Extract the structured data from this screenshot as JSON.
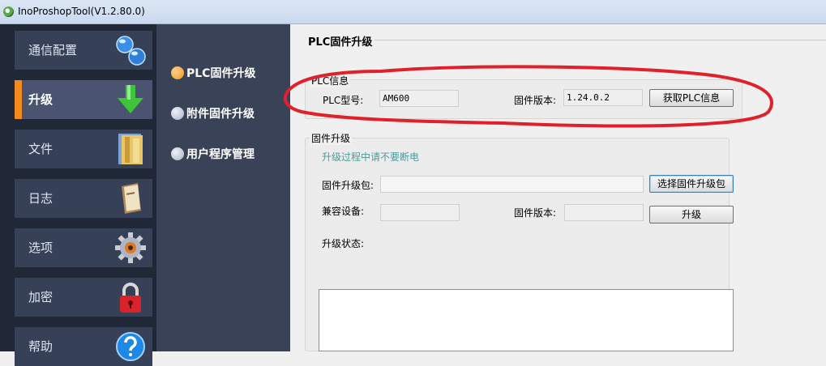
{
  "window": {
    "title": "InoProshopTool(V1.2.80.0)"
  },
  "sidebar": {
    "items": [
      {
        "label": "通信配置",
        "icon": "network-globes-icon"
      },
      {
        "label": "升级",
        "icon": "download-arrow-icon",
        "active": true
      },
      {
        "label": "文件",
        "icon": "folder-icon"
      },
      {
        "label": "日志",
        "icon": "book-icon"
      },
      {
        "label": "选项",
        "icon": "gear-icon"
      },
      {
        "label": "加密",
        "icon": "lock-icon"
      },
      {
        "label": "帮助",
        "icon": "help-icon"
      }
    ]
  },
  "submenu": {
    "items": [
      {
        "label": "PLC固件升级",
        "active": true
      },
      {
        "label": "附件固件升级"
      },
      {
        "label": "用户程序管理"
      }
    ]
  },
  "main": {
    "title": "PLC固件升级",
    "plc_info": {
      "group_title": "PLC信息",
      "model_label": "PLC型号:",
      "model_value": "AM600",
      "fw_version_label": "固件版本:",
      "fw_version_value": "1.24.0.2",
      "get_button": "获取PLC信息"
    },
    "firmware_upgrade": {
      "group_title": "固件升级",
      "hint": "升级过程中请不要断电",
      "package_label": "固件升级包:",
      "package_value": "",
      "select_button": "选择固件升级包",
      "compat_label": "兼容设备:",
      "compat_value": "",
      "fw_version_label": "固件版本:",
      "fw_version_value": "",
      "upgrade_button": "升级",
      "status_label": "升级状态:"
    }
  },
  "colors": {
    "sidebar_bg": "#202838",
    "nav_item_bg": "#364057",
    "accent": "#f28a1d",
    "annotation": "#e0202a"
  }
}
